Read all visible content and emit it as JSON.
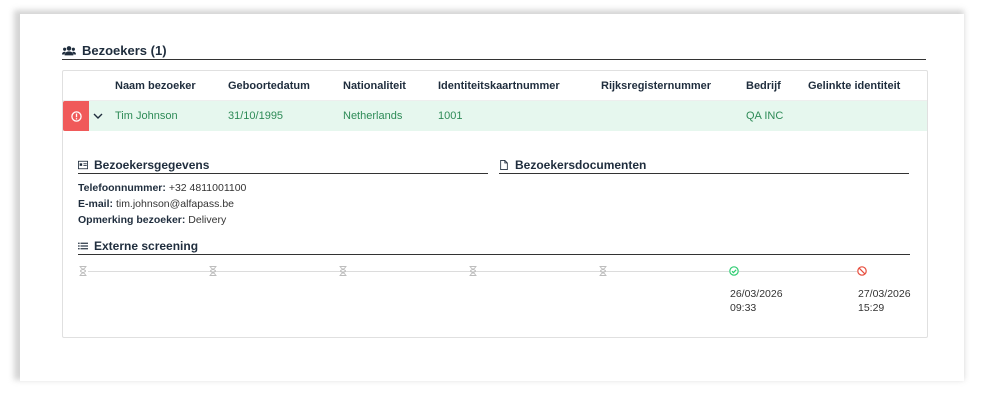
{
  "section": {
    "title": "Bezoekers (1)",
    "icon": "users-icon"
  },
  "table": {
    "columns": [
      "Naam bezoeker",
      "Geboortedatum",
      "Nationaliteit",
      "Identiteitskaartnummer",
      "Rijksregisternummer",
      "Bedrijf",
      "Gelinkte identiteit"
    ],
    "row": {
      "name": "Tim Johnson",
      "birthdate": "31/10/1995",
      "nationality": "Netherlands",
      "id_number": "1001",
      "national_register": "",
      "company": "QA INC",
      "linked_identity": ""
    }
  },
  "details": {
    "gegevens_title": "Bezoekersgegevens",
    "documenten_title": "Bezoekersdocumenten",
    "phone_label": "Telefoonnummer:",
    "phone": "+32 4811001100",
    "email_label": "E-mail:",
    "email": "tim.johnson@alfapass.be",
    "remark_label": "Opmerking bezoeker:",
    "remark": "Delivery"
  },
  "screening": {
    "title": "Externe screening",
    "steps": [
      {
        "status": "pending",
        "date": "",
        "time": ""
      },
      {
        "status": "pending",
        "date": "",
        "time": ""
      },
      {
        "status": "pending",
        "date": "",
        "time": ""
      },
      {
        "status": "pending",
        "date": "",
        "time": ""
      },
      {
        "status": "pending",
        "date": "",
        "time": ""
      },
      {
        "status": "success",
        "date": "26/03/2026",
        "time": "09:33"
      },
      {
        "status": "denied",
        "date": "27/03/2026",
        "time": "15:29"
      }
    ]
  },
  "colors": {
    "row_bg": "#e6f7ee",
    "row_text": "#2e8b57",
    "alert": "#f05a5a",
    "success": "#2ecc71",
    "denied": "#e74c3c",
    "pending": "#bdbdbd"
  }
}
